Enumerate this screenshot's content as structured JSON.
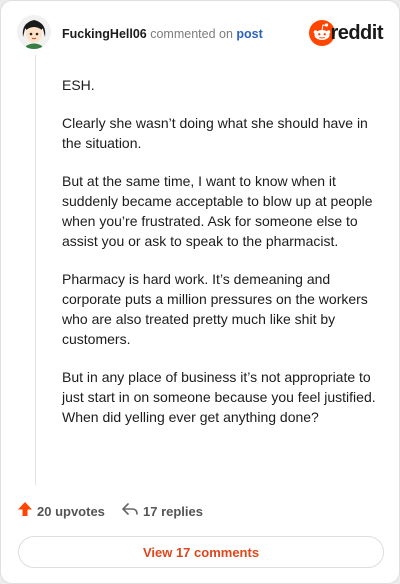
{
  "comment": {
    "username": "FuckingHell06",
    "action_text": "commented on",
    "target": "post",
    "paragraphs": [
      "ESH.",
      "Clearly she wasn’t doing what she should have in the situation.",
      "But at the same time, I want to know when it suddenly became acceptable to blow up at people when you’re frustrated. Ask for someone else to assist you or ask to speak to the pharmacist.",
      "Pharmacy is hard work. It’s demeaning and corporate puts a million pressures on the workers who are also treated pretty much like shit by customers.",
      "But in any place of business it’s not appropriate to just start in on someone because you feel justified. When did yelling ever get anything done?"
    ]
  },
  "brand": {
    "name": "reddit",
    "color": "#ff4500"
  },
  "actions": {
    "upvotes": "20 upvotes",
    "replies": "17 replies"
  },
  "footer": {
    "view_comments": "View 17 comments"
  },
  "colors": {
    "accent": "#e0461b",
    "upvote": "#ff4500",
    "link": "#2b63b8"
  },
  "icons": [
    "avatar",
    "reddit-logo-icon",
    "upvote-arrow-icon",
    "reply-arrow-icon"
  ]
}
